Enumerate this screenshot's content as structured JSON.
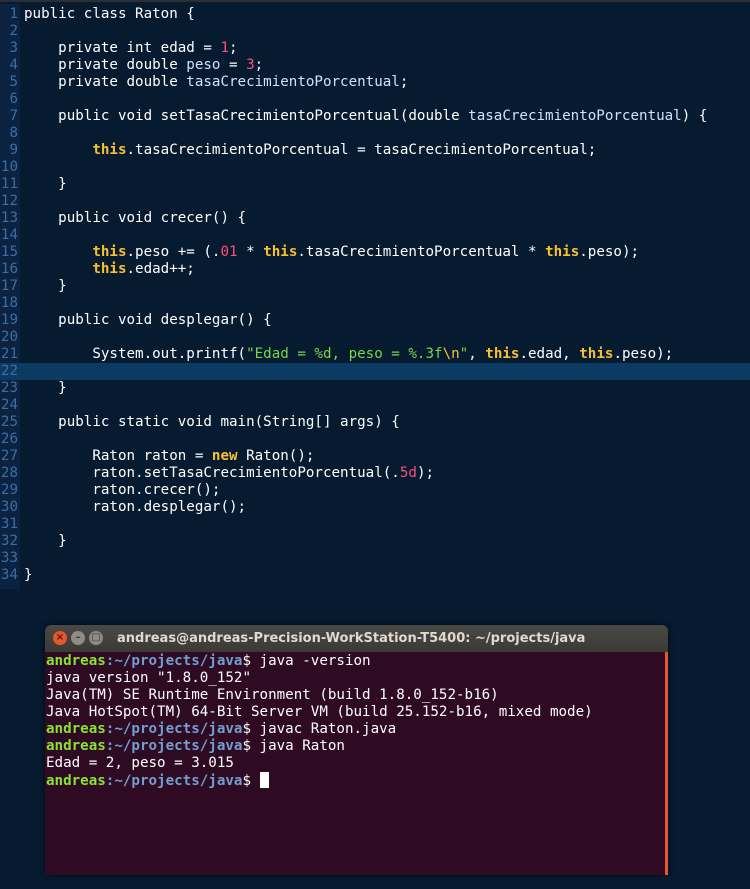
{
  "editor": {
    "lines": [
      {
        "n": "1",
        "segs": [
          {
            "t": "public class Raton {",
            "c": ""
          }
        ]
      },
      {
        "n": "2",
        "segs": []
      },
      {
        "n": "3",
        "segs": [
          {
            "t": "    private int edad = ",
            "c": ""
          },
          {
            "t": "1",
            "c": "num"
          },
          {
            "t": ";",
            "c": ""
          }
        ]
      },
      {
        "n": "4",
        "segs": [
          {
            "t": "    private double ",
            "c": ""
          },
          {
            "t": "peso",
            "c": "md"
          },
          {
            "t": " = ",
            "c": ""
          },
          {
            "t": "3",
            "c": "num"
          },
          {
            "t": ";",
            "c": ""
          }
        ]
      },
      {
        "n": "5",
        "segs": [
          {
            "t": "    private double ",
            "c": ""
          },
          {
            "t": "tasaCrecimientoPorcentual",
            "c": "md"
          },
          {
            "t": ";",
            "c": ""
          }
        ]
      },
      {
        "n": "6",
        "segs": []
      },
      {
        "n": "7",
        "segs": [
          {
            "t": "    public void setTasaCrecimientoPorcentual(double ",
            "c": ""
          },
          {
            "t": "tasaCrecimientoPorcentual",
            "c": "md"
          },
          {
            "t": ") {",
            "c": ""
          }
        ]
      },
      {
        "n": "8",
        "segs": []
      },
      {
        "n": "9",
        "segs": [
          {
            "t": "        ",
            "c": ""
          },
          {
            "t": "this",
            "c": "kw"
          },
          {
            "t": ".tasaCrecimientoPorcentual = tasaCrecimientoPorcentual;",
            "c": ""
          }
        ]
      },
      {
        "n": "10",
        "segs": []
      },
      {
        "n": "11",
        "segs": [
          {
            "t": "    }",
            "c": ""
          }
        ]
      },
      {
        "n": "12",
        "segs": []
      },
      {
        "n": "13",
        "segs": [
          {
            "t": "    public void crecer() {",
            "c": ""
          }
        ]
      },
      {
        "n": "14",
        "segs": []
      },
      {
        "n": "15",
        "segs": [
          {
            "t": "        ",
            "c": ""
          },
          {
            "t": "this",
            "c": "kw"
          },
          {
            "t": ".peso += (.",
            "c": ""
          },
          {
            "t": "01",
            "c": "num"
          },
          {
            "t": " * ",
            "c": ""
          },
          {
            "t": "this",
            "c": "kw"
          },
          {
            "t": ".tasaCrecimientoPorcentual * ",
            "c": ""
          },
          {
            "t": "this",
            "c": "kw"
          },
          {
            "t": ".peso);",
            "c": ""
          }
        ]
      },
      {
        "n": "16",
        "segs": [
          {
            "t": "        ",
            "c": ""
          },
          {
            "t": "this",
            "c": "kw"
          },
          {
            "t": ".edad++;",
            "c": ""
          }
        ]
      },
      {
        "n": "17",
        "segs": [
          {
            "t": "    }",
            "c": ""
          }
        ]
      },
      {
        "n": "18",
        "segs": []
      },
      {
        "n": "19",
        "segs": [
          {
            "t": "    public void desplegar() {",
            "c": ""
          }
        ]
      },
      {
        "n": "20",
        "segs": []
      },
      {
        "n": "21",
        "segs": [
          {
            "t": "        System.out.printf(",
            "c": ""
          },
          {
            "t": "\"Edad = %d, peso = %.3f",
            "c": "str"
          },
          {
            "t": "\\n",
            "c": "esc"
          },
          {
            "t": "\"",
            "c": "str"
          },
          {
            "t": ", ",
            "c": ""
          },
          {
            "t": "this",
            "c": "kw"
          },
          {
            "t": ".edad, ",
            "c": ""
          },
          {
            "t": "this",
            "c": "kw"
          },
          {
            "t": ".peso);",
            "c": ""
          }
        ]
      },
      {
        "n": "22",
        "segs": [],
        "current": true
      },
      {
        "n": "23",
        "segs": [
          {
            "t": "    }",
            "c": ""
          }
        ]
      },
      {
        "n": "24",
        "segs": []
      },
      {
        "n": "25",
        "segs": [
          {
            "t": "    public static void main(String[] args) {",
            "c": ""
          }
        ]
      },
      {
        "n": "26",
        "segs": []
      },
      {
        "n": "27",
        "segs": [
          {
            "t": "        Raton raton = ",
            "c": ""
          },
          {
            "t": "new",
            "c": "kw"
          },
          {
            "t": " Raton();",
            "c": ""
          }
        ]
      },
      {
        "n": "28",
        "segs": [
          {
            "t": "        raton.setTasaCrecimientoPorcentual(.",
            "c": ""
          },
          {
            "t": "5d",
            "c": "num"
          },
          {
            "t": ");",
            "c": ""
          }
        ]
      },
      {
        "n": "29",
        "segs": [
          {
            "t": "        raton.crecer();",
            "c": ""
          }
        ]
      },
      {
        "n": "30",
        "segs": [
          {
            "t": "        raton.desplegar();",
            "c": ""
          }
        ]
      },
      {
        "n": "31",
        "segs": []
      },
      {
        "n": "32",
        "segs": [
          {
            "t": "    }",
            "c": ""
          }
        ]
      },
      {
        "n": "33",
        "segs": []
      },
      {
        "n": "34",
        "segs": [
          {
            "t": "}",
            "c": ""
          }
        ]
      }
    ]
  },
  "terminal": {
    "title": "andreas@andreas-Precision-WorkStation-T5400: ~/projects/java",
    "close_glyph": "×",
    "minimize_glyph": "–",
    "maximize_glyph": "□",
    "lines": [
      {
        "prompt": true,
        "user": "andreas",
        "path": ":~/projects/java",
        "text": "$ java -version"
      },
      {
        "prompt": false,
        "text": "java version \"1.8.0_152\""
      },
      {
        "prompt": false,
        "text": "Java(TM) SE Runtime Environment (build 1.8.0_152-b16)"
      },
      {
        "prompt": false,
        "text": "Java HotSpot(TM) 64-Bit Server VM (build 25.152-b16, mixed mode)"
      },
      {
        "prompt": true,
        "user": "andreas",
        "path": ":~/projects/java",
        "text": "$ javac Raton.java"
      },
      {
        "prompt": true,
        "user": "andreas",
        "path": ":~/projects/java",
        "text": "$ java Raton"
      },
      {
        "prompt": false,
        "text": "Edad = 2, peso = 3.015"
      },
      {
        "prompt": true,
        "user": "andreas",
        "path": ":~/projects/java",
        "text": "$ ",
        "cursor": true
      }
    ]
  },
  "colors": {
    "editor_bg": "#061a30",
    "keyword": "#fac12e",
    "number": "#ff4f7a",
    "string": "#78d64b",
    "terminal_bg": "#2e0a23",
    "prompt_user": "#8ae234",
    "prompt_path": "#729fcf"
  }
}
